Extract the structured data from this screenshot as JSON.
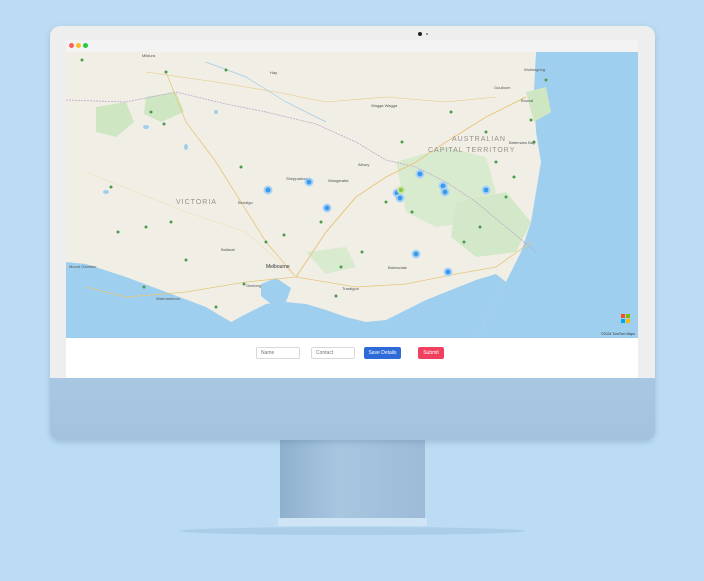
{
  "map": {
    "region_labels": {
      "victoria": "VICTORIA",
      "act_line1": "AUSTRALIAN",
      "act_line2": "CAPITAL TERRITORY"
    },
    "cities": {
      "mildura": "Mildura",
      "hay": "Hay",
      "wagga": "Wagga Wagga",
      "goulburn": "Goulburn",
      "wollongong": "Wollongong",
      "batemans": "Batemans Bay",
      "bowral": "Bowral",
      "shepparton": "Shepparton",
      "wangaratta": "Wangaratta",
      "albury": "Albury",
      "bendigo": "Bendigo",
      "ballarat": "Ballarat",
      "melbourne": "Melbourne",
      "geelong": "Geelong",
      "mount_gambier": "Mount Gambier",
      "traralgon": "Traralgon",
      "bairnsdale": "Bairnsdale",
      "warrnambool": "Warrnambool"
    },
    "copyright": "©2024 TomTom Maps",
    "colors": {
      "water": "#9fcfee",
      "land": "#f1eee6",
      "park": "#cfe6c3",
      "marker": "#3b9be8"
    }
  },
  "form": {
    "name_placeholder": "Name",
    "contact_placeholder": "Contact",
    "save_label": "Save Details",
    "submit_label": "Submit",
    "save_color": "#2f6bd8",
    "submit_color": "#f04060"
  }
}
